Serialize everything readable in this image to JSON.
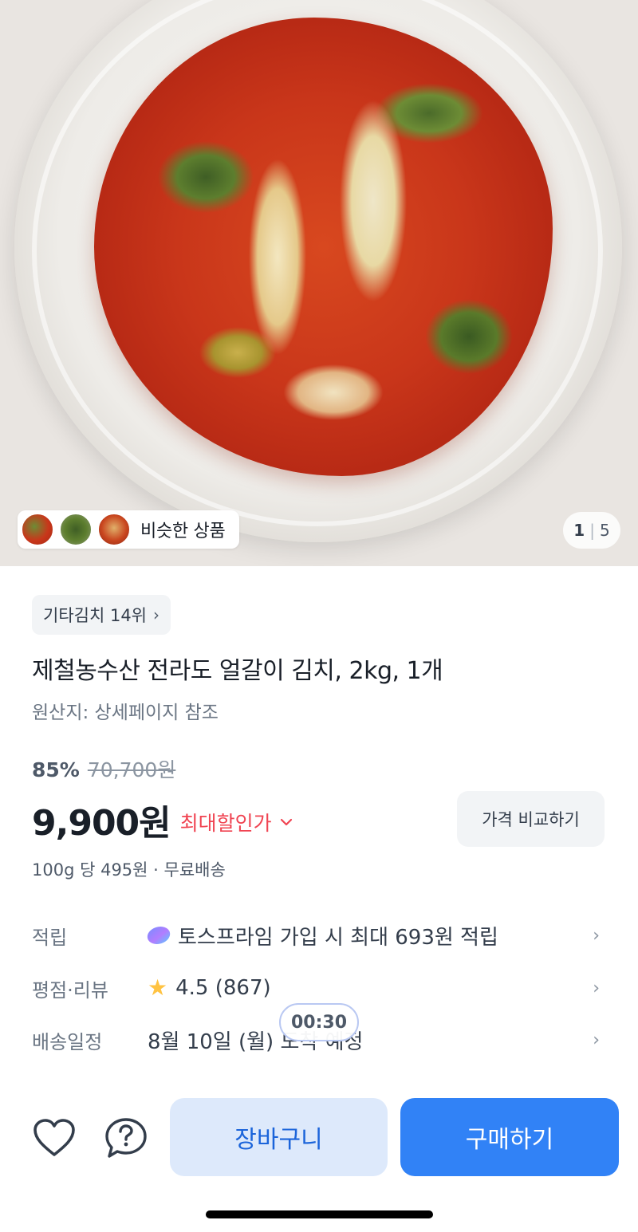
{
  "gallery": {
    "similar_products_label": "비슷한 상품",
    "current_page": "1",
    "total_pages": "5"
  },
  "product": {
    "rank_label": "기타김치 14위",
    "title": "제철농수산 전라도 얼갈이 김치, 2kg, 1개",
    "origin": "원산지: 상세페이지 참조",
    "discount_rate": "85%",
    "original_price": "70,700원",
    "price": "9,900원",
    "max_discount_label": "최대할인가",
    "compare_button": "가격 비교하기",
    "unit_price": "100g 당 495원 · 무료배송"
  },
  "info_rows": [
    {
      "label": "적립",
      "value": "토스프라임 가입 시 최대 693원 적립",
      "icon": "prime-icon"
    },
    {
      "label": "평점·리뷰",
      "value": "4.5 (867)",
      "icon": "star-icon"
    },
    {
      "label": "배송일정",
      "value": "8월 10일 (월) 도착 예정",
      "icon": ""
    }
  ],
  "timer": "00:30",
  "bottom_bar": {
    "cart_button": "장바구니",
    "buy_button": "구매하기"
  },
  "colors": {
    "primary": "#3182f6",
    "cart_bg": "#dde9fb",
    "discount_red": "#f04452",
    "star": "#ffc342"
  }
}
